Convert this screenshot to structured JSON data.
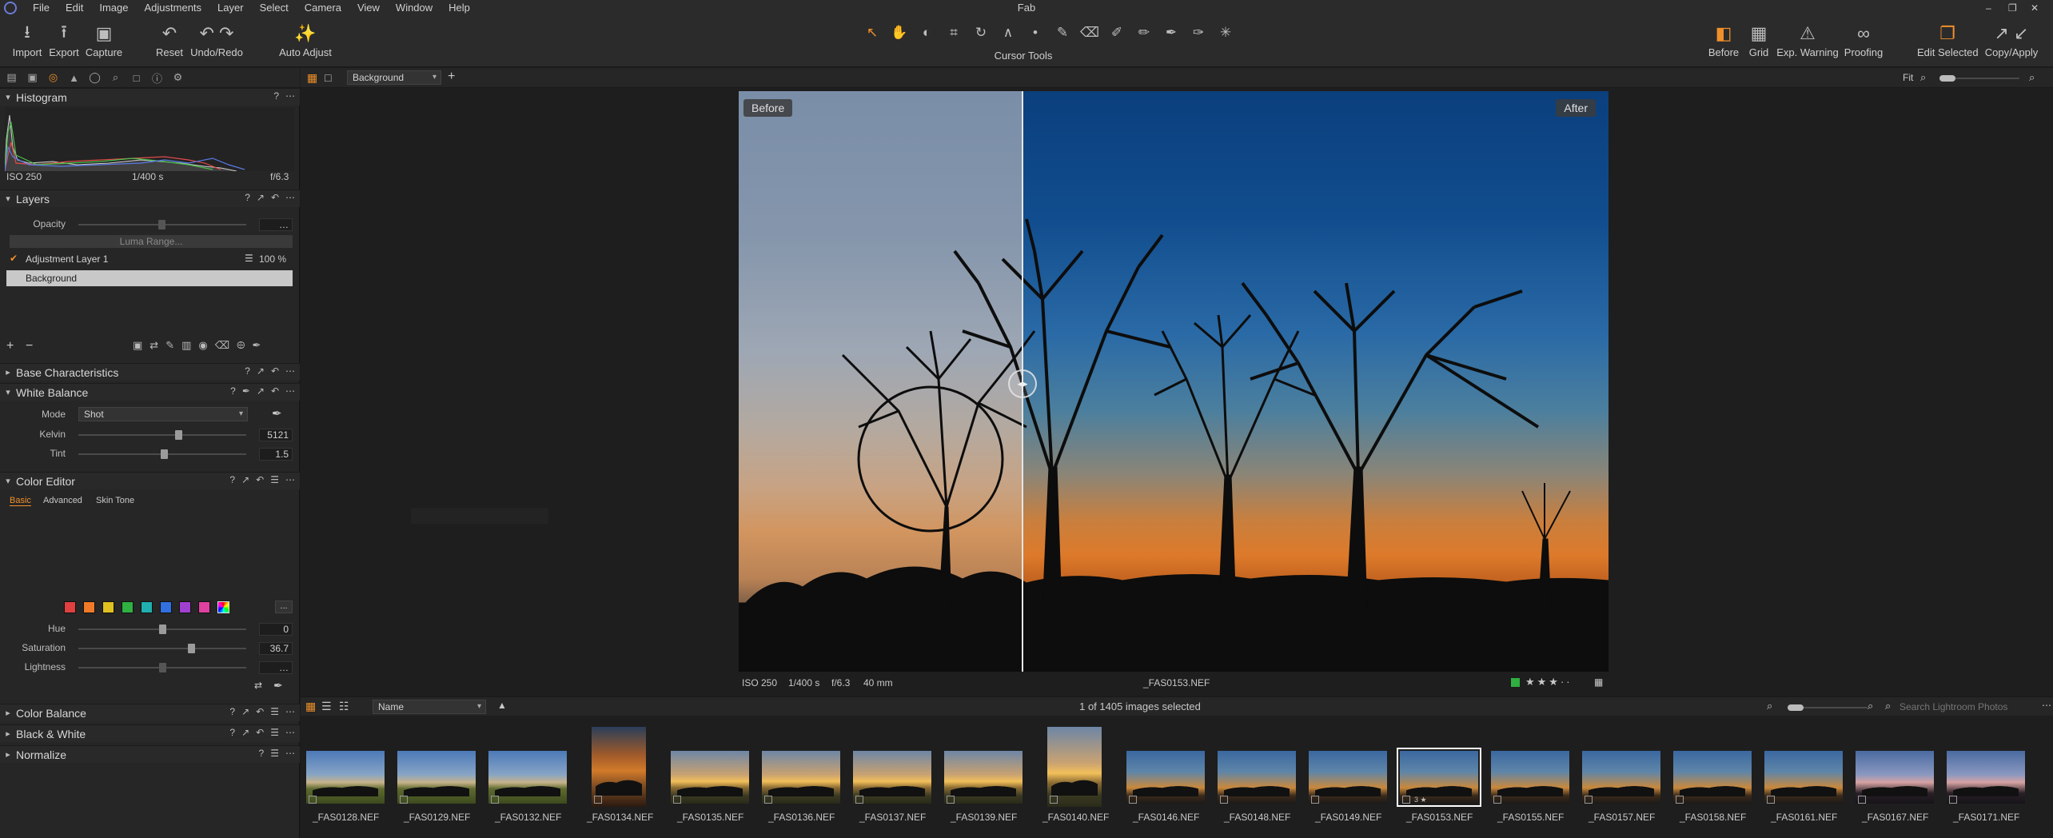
{
  "window": {
    "title": "Fab"
  },
  "menu": [
    "File",
    "Edit",
    "Image",
    "Adjustments",
    "Layer",
    "Select",
    "Camera",
    "View",
    "Window",
    "Help"
  ],
  "toolbar": {
    "left": [
      {
        "label": "Import",
        "icon": "import-icon"
      },
      {
        "label": "Export",
        "icon": "export-icon"
      },
      {
        "label": "Capture",
        "icon": "camera-icon"
      },
      {
        "label": "Reset",
        "icon": "reset-icon"
      },
      {
        "label": "Undo/Redo",
        "icon": "undo-icon"
      },
      {
        "label": "Auto Adjust",
        "icon": "wand-icon"
      }
    ],
    "cursor_tools_label": "Cursor Tools",
    "right": [
      {
        "label": "Before",
        "icon": "before-after-icon"
      },
      {
        "label": "Grid",
        "icon": "grid-icon"
      },
      {
        "label": "Exp. Warning",
        "icon": "warning-icon"
      },
      {
        "label": "Proofing",
        "icon": "proofing-glasses-icon"
      },
      {
        "label": "Edit Selected",
        "icon": "edit-selected-icon"
      },
      {
        "label": "Copy/Apply",
        "icon": "copy-apply-icon"
      }
    ]
  },
  "histogram": {
    "title": "Histogram",
    "iso": "ISO 250",
    "shutter": "1/400 s",
    "aperture": "f/6.3"
  },
  "layers": {
    "title": "Layers",
    "opacity_label": "Opacity",
    "luma_range_label": "Luma Range...",
    "items": [
      {
        "name": "Adjustment Layer 1",
        "opacity": "100 %",
        "checked": true
      },
      {
        "name": "Background",
        "selected": true
      }
    ]
  },
  "sections": {
    "base_characteristics": "Base Characteristics",
    "white_balance": "White Balance",
    "color_editor": "Color Editor",
    "color_balance": "Color Balance",
    "black_white": "Black & White",
    "normalize": "Normalize"
  },
  "white_balance": {
    "mode_label": "Mode",
    "mode_value": "Shot",
    "kelvin_label": "Kelvin",
    "kelvin_value": "5121",
    "kelvin_level": 0.6,
    "tint_label": "Tint",
    "tint_value": "1.5",
    "tint_level": 0.51
  },
  "color_editor": {
    "tabs": [
      "Basic",
      "Advanced",
      "Skin Tone"
    ],
    "active_tab": "Basic",
    "swatches": [
      "#e04040",
      "#f07a2a",
      "#e0c020",
      "#2fb040",
      "#20b0b0",
      "#3070e0",
      "#a040d0",
      "#e040a0"
    ],
    "more_label": "...",
    "hue_label": "Hue",
    "hue_value": "0",
    "hue_level": 0.5,
    "saturation_label": "Saturation",
    "saturation_value": "36.7",
    "saturation_level": 0.68,
    "lightness_label": "Lightness",
    "lightness_level": 0.5
  },
  "viewer": {
    "variant_dropdown": "Background",
    "zoom_label": "Fit",
    "before_label": "Before",
    "after_label": "After",
    "photo_info": {
      "iso": "ISO 250",
      "shutter": "1/400 s",
      "aperture": "f/6.3",
      "focal": "40 mm",
      "filename": "_FAS0153.NEF"
    },
    "rating": 3,
    "color_tag": "#2fb040"
  },
  "browser": {
    "sort_dropdown": "Name",
    "count_text": "1 of 1405 images selected",
    "search_placeholder": "Search Lightroom Photos",
    "thumbnails": [
      {
        "name": "_FAS0128.NEF",
        "style": "field"
      },
      {
        "name": "_FAS0129.NEF",
        "style": "field"
      },
      {
        "name": "_FAS0132.NEF",
        "style": "field"
      },
      {
        "name": "_FAS0134.NEF",
        "style": "orange",
        "portrait": true
      },
      {
        "name": "_FAS0135.NEF",
        "style": "golden"
      },
      {
        "name": "_FAS0136.NEF",
        "style": "golden"
      },
      {
        "name": "_FAS0137.NEF",
        "style": "golden"
      },
      {
        "name": "_FAS0139.NEF",
        "style": "golden"
      },
      {
        "name": "_FAS0140.NEF",
        "style": "golden",
        "portrait": true
      },
      {
        "name": "_FAS0146.NEF",
        "style": "dusk"
      },
      {
        "name": "_FAS0148.NEF",
        "style": "dusk"
      },
      {
        "name": "_FAS0149.NEF",
        "style": "dusk"
      },
      {
        "name": "_FAS0153.NEF",
        "style": "dusk",
        "selected": true,
        "badge": "3 ★"
      },
      {
        "name": "_FAS0155.NEF",
        "style": "dusk"
      },
      {
        "name": "_FAS0157.NEF",
        "style": "dusk"
      },
      {
        "name": "_FAS0158.NEF",
        "style": "dusk"
      },
      {
        "name": "_FAS0161.NEF",
        "style": "dusk"
      },
      {
        "name": "_FAS0167.NEF",
        "style": "pinkdusk"
      },
      {
        "name": "_FAS0171.NEF",
        "style": "pinkdusk"
      }
    ]
  }
}
